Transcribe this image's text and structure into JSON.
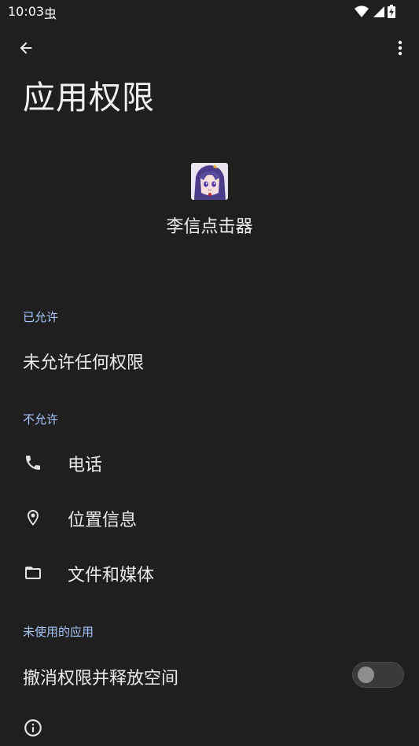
{
  "status_bar": {
    "time": "10:03",
    "bug_glyph": "虫",
    "icons": [
      "wifi-icon",
      "signal-icon",
      "battery-charging-icon"
    ]
  },
  "app_bar": {
    "back_icon": "arrow-back-icon",
    "more_icon": "more-vert-icon"
  },
  "page": {
    "title": "应用权限"
  },
  "app": {
    "name": "李信点击器",
    "icon": "anime-avatar-icon"
  },
  "sections": {
    "allowed": {
      "header": "已允许",
      "empty_text": "未允许任何权限"
    },
    "not_allowed": {
      "header": "不允许",
      "items": [
        {
          "label": "电话",
          "icon": "phone-icon"
        },
        {
          "label": "位置信息",
          "icon": "location-icon"
        },
        {
          "label": "文件和媒体",
          "icon": "folder-icon"
        }
      ]
    },
    "unused_apps": {
      "header": "未使用的应用",
      "toggle_label": "撤消权限并释放空间",
      "toggle_on": false
    }
  },
  "footer": {
    "icon": "info-icon"
  },
  "colors": {
    "background": "#1f1f1f",
    "section_header": "#a8c7fa",
    "text_primary": "#ececec"
  }
}
